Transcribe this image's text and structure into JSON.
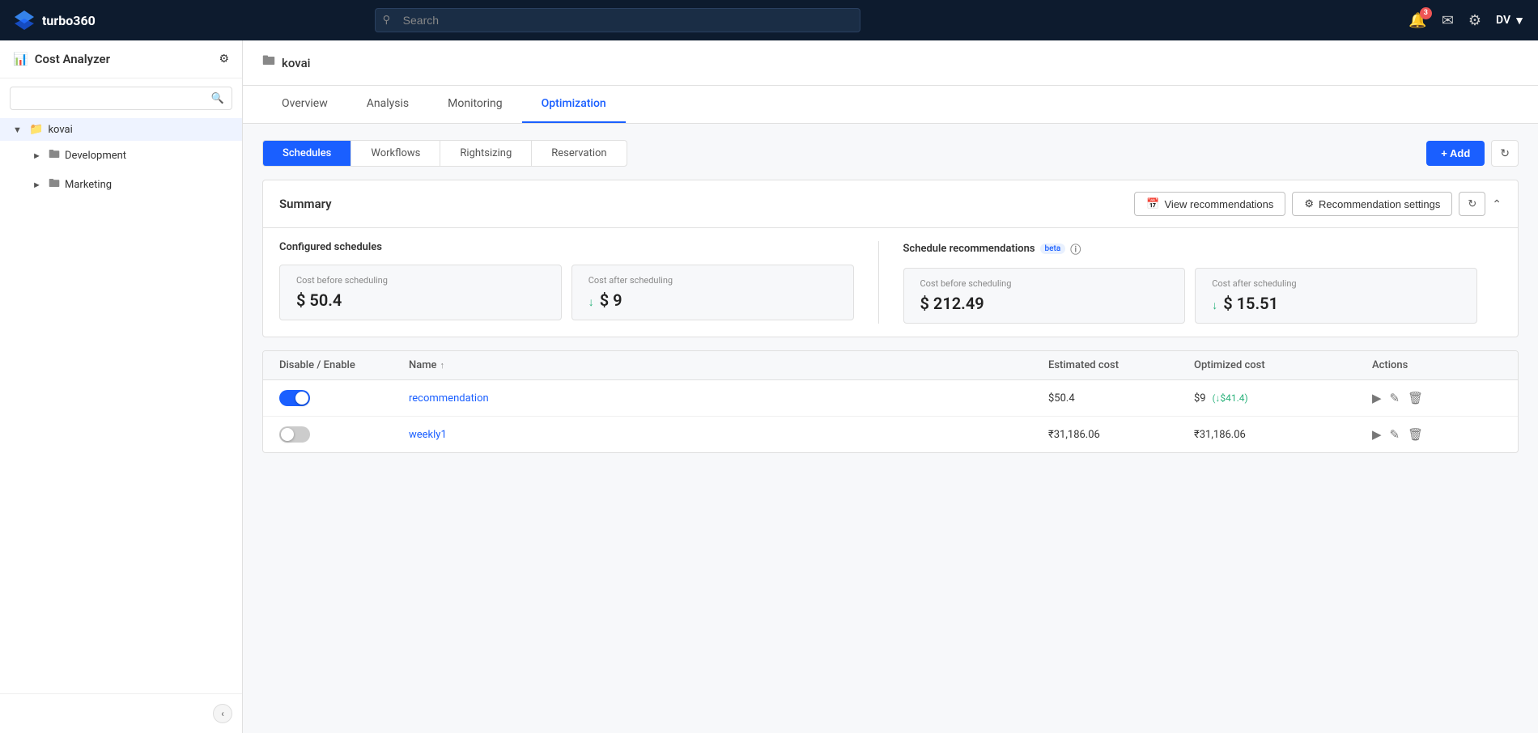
{
  "app": {
    "name": "turbo360",
    "logo_text": "turbo360"
  },
  "topnav": {
    "search_placeholder": "Search",
    "notification_badge": "3",
    "user_initials": "DV"
  },
  "sidebar": {
    "title": "Cost Analyzer",
    "search_placeholder": "",
    "tree": [
      {
        "id": "kovai",
        "label": "kovai",
        "expanded": true,
        "active": true,
        "level": 0
      },
      {
        "id": "development",
        "label": "Development",
        "expanded": false,
        "active": false,
        "level": 1
      },
      {
        "id": "marketing",
        "label": "Marketing",
        "expanded": false,
        "active": false,
        "level": 1
      }
    ],
    "collapse_btn_label": "‹"
  },
  "page_header": {
    "folder_label": "kovai"
  },
  "main_tabs": [
    {
      "id": "overview",
      "label": "Overview"
    },
    {
      "id": "analysis",
      "label": "Analysis"
    },
    {
      "id": "monitoring",
      "label": "Monitoring"
    },
    {
      "id": "optimization",
      "label": "Optimization",
      "active": true
    }
  ],
  "sub_tabs": [
    {
      "id": "schedules",
      "label": "Schedules",
      "active": true
    },
    {
      "id": "workflows",
      "label": "Workflows"
    },
    {
      "id": "rightsizing",
      "label": "Rightsizing"
    },
    {
      "id": "reservation",
      "label": "Reservation"
    }
  ],
  "toolbar": {
    "add_label": "+ Add"
  },
  "summary": {
    "title": "Summary",
    "view_recommendations_label": "View recommendations",
    "recommendation_settings_label": "Recommendation settings",
    "configured": {
      "title": "Configured schedules",
      "cost_before_label": "Cost before scheduling",
      "cost_before_value": "$ 50.4",
      "cost_after_label": "Cost after scheduling",
      "cost_after_value": "$ 9"
    },
    "recommendations": {
      "title": "Schedule recommendations",
      "beta_label": "beta",
      "cost_before_label": "Cost before scheduling",
      "cost_before_value": "$ 212.49",
      "cost_after_label": "Cost after scheduling",
      "cost_after_value": "$ 15.51"
    }
  },
  "table": {
    "columns": [
      {
        "id": "disable_enable",
        "label": "Disable / Enable"
      },
      {
        "id": "name",
        "label": "Name",
        "sortable": true
      },
      {
        "id": "estimated_cost",
        "label": "Estimated cost"
      },
      {
        "id": "optimized_cost",
        "label": "Optimized cost"
      },
      {
        "id": "actions",
        "label": "Actions"
      }
    ],
    "rows": [
      {
        "id": "row1",
        "toggle": true,
        "name": "recommendation",
        "estimated_cost": "$50.4",
        "optimized_cost": "$9",
        "savings": "↓$41.4"
      },
      {
        "id": "row2",
        "toggle": false,
        "name": "weekly1",
        "estimated_cost": "₹31,186.06",
        "optimized_cost": "₹31,186.06",
        "savings": ""
      }
    ]
  }
}
